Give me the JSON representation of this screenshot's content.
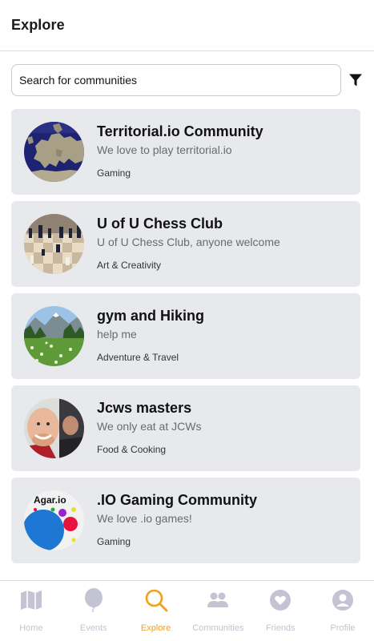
{
  "header": {
    "title": "Explore"
  },
  "search": {
    "placeholder": "Search for communities"
  },
  "communities": [
    {
      "name": "Territorial.io Community",
      "description": "We love to play territorial.io",
      "category": "Gaming",
      "avatar": "europe-map"
    },
    {
      "name": "U of U Chess Club",
      "description": "U of U Chess Club, anyone welcome",
      "category": "Art & Creativity",
      "avatar": "chess-board"
    },
    {
      "name": "gym and Hiking",
      "description": "help me",
      "category": "Adventure & Travel",
      "avatar": "mountain-meadow"
    },
    {
      "name": "Jcws masters",
      "description": "We only eat at JCWs",
      "category": "Food & Cooking",
      "avatar": "person-selfie"
    },
    {
      "name": ".IO Gaming Community",
      "description": "We love .io games!",
      "category": "Gaming",
      "avatar": "agar-io-logo",
      "avatar_text": "Agar.io"
    }
  ],
  "tabs": [
    {
      "label": "Home",
      "icon": "map-icon"
    },
    {
      "label": "Events",
      "icon": "balloon-icon"
    },
    {
      "label": "Explore",
      "icon": "search-icon",
      "active": true
    },
    {
      "label": "Communities",
      "icon": "people-icon"
    },
    {
      "label": "Friends",
      "icon": "heart-icon"
    },
    {
      "label": "Profile",
      "icon": "user-icon"
    }
  ],
  "colors": {
    "active_tab": "#f0a01e",
    "inactive_tab": "#c3c3d3",
    "card_bg": "#e7e9ed"
  }
}
